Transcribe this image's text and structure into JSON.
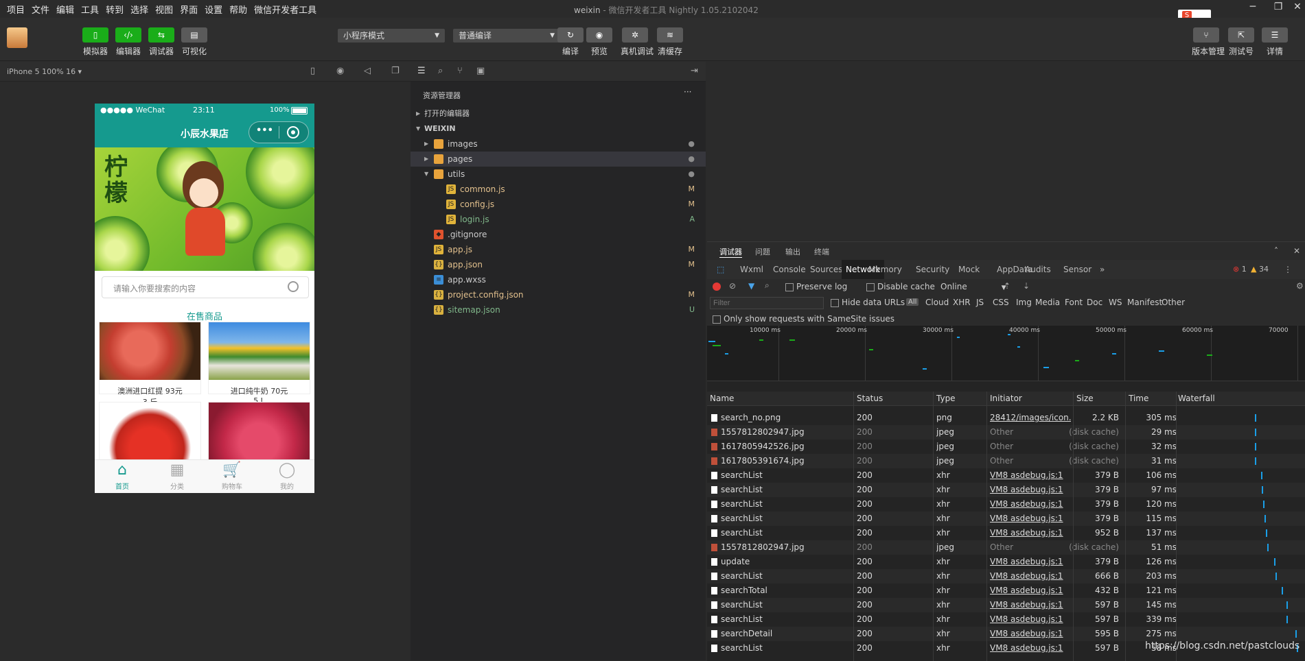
{
  "menu": [
    "项目",
    "文件",
    "编辑",
    "工具",
    "转到",
    "选择",
    "视图",
    "界面",
    "设置",
    "帮助",
    "微信开发者工具"
  ],
  "window": {
    "title": "weixin",
    "subtitle": "- 微信开发者工具 Nightly 1.05.2102042",
    "minimize": "─",
    "maximize": "❐",
    "close": "✕"
  },
  "toolbar": {
    "left_buttons": [
      {
        "label": "模拟器",
        "icon": "phone-icon"
      },
      {
        "label": "编辑器",
        "icon": "code-icon"
      },
      {
        "label": "调试器",
        "icon": "debug-icon"
      },
      {
        "label": "可视化",
        "icon": "layout-icon"
      }
    ],
    "mode_select": "小程序模式",
    "compile_select": "普通编译",
    "mid_buttons": [
      {
        "label": "编译",
        "icon": "refresh-icon"
      },
      {
        "label": "预览",
        "icon": "eye-icon"
      },
      {
        "label": "真机调试",
        "icon": "bug-icon"
      },
      {
        "label": "清缓存",
        "icon": "layers-icon"
      }
    ],
    "right_buttons": [
      {
        "label": "版本管理",
        "icon": "branch-icon"
      },
      {
        "label": "测试号",
        "icon": "share-icon"
      },
      {
        "label": "详情",
        "icon": "menu-icon"
      }
    ]
  },
  "simulator": {
    "device_label": "iPhone 5 100% 16 ▾",
    "status": {
      "carrier": "●●●●● WeChat",
      "time": "23:11",
      "battery": "100%"
    },
    "nav_title": "小辰水果店",
    "banner_text": "柠檬",
    "search_placeholder": "请输入你要搜索的内容",
    "section_title": "在售商品",
    "products": [
      {
        "name": "澳洲进口红提 93元",
        "spec": "3 斤"
      },
      {
        "name": "进口纯牛奶 70元",
        "spec": "5 L"
      },
      {
        "name": "",
        "spec": ""
      },
      {
        "name": "",
        "spec": ""
      }
    ],
    "tabs": [
      {
        "label": "首页",
        "icon": "home-icon",
        "active": true
      },
      {
        "label": "分类",
        "icon": "grid-icon",
        "active": false
      },
      {
        "label": "购物车",
        "icon": "cart-icon",
        "active": false
      },
      {
        "label": "我的",
        "icon": "user-icon",
        "active": false
      }
    ],
    "accent": "#159a8e"
  },
  "explorer": {
    "header": "资源管理器",
    "more": "···",
    "open_editors": "打开的编辑器",
    "root": "WEIXIN",
    "files": [
      {
        "name": "images",
        "type": "folder",
        "status": "●",
        "depth": 1
      },
      {
        "name": "pages",
        "type": "folder",
        "status": "●",
        "depth": 1
      },
      {
        "name": "utils",
        "type": "folder",
        "status": "●",
        "depth": 1
      },
      {
        "name": "common.js",
        "type": "js",
        "status": "M",
        "depth": 2
      },
      {
        "name": "config.js",
        "type": "js",
        "status": "M",
        "depth": 2
      },
      {
        "name": "login.js",
        "type": "js",
        "status": "A",
        "depth": 2
      },
      {
        "name": ".gitignore",
        "type": "git",
        "status": "",
        "depth": 1
      },
      {
        "name": "app.js",
        "type": "js",
        "status": "M",
        "depth": 1
      },
      {
        "name": "app.json",
        "type": "json",
        "status": "M",
        "depth": 1
      },
      {
        "name": "app.wxss",
        "type": "wxss",
        "status": "",
        "depth": 1
      },
      {
        "name": "project.config.json",
        "type": "json",
        "status": "M",
        "depth": 1
      },
      {
        "name": "sitemap.json",
        "type": "json",
        "status": "U",
        "depth": 1
      }
    ]
  },
  "devtools": {
    "top_tabs": [
      "调试器",
      "问题",
      "输出",
      "终端"
    ],
    "panel_tabs": [
      "Wxml",
      "Console",
      "Sources",
      "Network",
      "Memory",
      "Security",
      "Mock",
      "AppData",
      "Audits",
      "Sensor"
    ],
    "active_panel": "Network",
    "error_count": "1",
    "warn_count": "34",
    "preserve_log": "Preserve log",
    "disable_cache": "Disable cache",
    "throttle": "Online",
    "filter_placeholder": "Filter",
    "hide_data_urls": "Hide data URLs",
    "types": [
      "All",
      "Cloud",
      "XHR",
      "JS",
      "CSS",
      "Img",
      "Media",
      "Font",
      "Doc",
      "WS",
      "Manifest",
      "Other"
    ],
    "samesite": "Only show requests with SameSite issues",
    "ticks": [
      "10000 ms",
      "20000 ms",
      "30000 ms",
      "40000 ms",
      "50000 ms",
      "60000 ms",
      "70000"
    ],
    "columns": [
      "Name",
      "Status",
      "Type",
      "Initiator",
      "Size",
      "Time",
      "Waterfall"
    ],
    "requests": [
      {
        "name": "search_no.png",
        "status": "200",
        "type": "png",
        "initiator": "28412/images/icon...",
        "size": "2.2 KB",
        "time": "305 ms",
        "cached": false,
        "wf": 0.62
      },
      {
        "name": "1557812802947.jpg",
        "status": "200",
        "type": "jpeg",
        "initiator": "Other",
        "size": "(disk cache)",
        "time": "29 ms",
        "cached": true,
        "wf": 0.62
      },
      {
        "name": "1617805942526.jpg",
        "status": "200",
        "type": "jpeg",
        "initiator": "Other",
        "size": "(disk cache)",
        "time": "32 ms",
        "cached": true,
        "wf": 0.62
      },
      {
        "name": "1617805391674.jpg",
        "status": "200",
        "type": "jpeg",
        "initiator": "Other",
        "size": "(disk cache)",
        "time": "31 ms",
        "cached": true,
        "wf": 0.62
      },
      {
        "name": "searchList",
        "status": "200",
        "type": "xhr",
        "initiator": "VM8 asdebug.js:1",
        "size": "379 B",
        "time": "106 ms",
        "cached": false,
        "wf": 0.67
      },
      {
        "name": "searchList",
        "status": "200",
        "type": "xhr",
        "initiator": "VM8 asdebug.js:1",
        "size": "379 B",
        "time": "97 ms",
        "cached": false,
        "wf": 0.68
      },
      {
        "name": "searchList",
        "status": "200",
        "type": "xhr",
        "initiator": "VM8 asdebug.js:1",
        "size": "379 B",
        "time": "120 ms",
        "cached": false,
        "wf": 0.69
      },
      {
        "name": "searchList",
        "status": "200",
        "type": "xhr",
        "initiator": "VM8 asdebug.js:1",
        "size": "379 B",
        "time": "115 ms",
        "cached": false,
        "wf": 0.7
      },
      {
        "name": "searchList",
        "status": "200",
        "type": "xhr",
        "initiator": "VM8 asdebug.js:1",
        "size": "952 B",
        "time": "137 ms",
        "cached": false,
        "wf": 0.71
      },
      {
        "name": "1557812802947.jpg",
        "status": "200",
        "type": "jpeg",
        "initiator": "Other",
        "size": "(disk cache)",
        "time": "51 ms",
        "cached": true,
        "wf": 0.72
      },
      {
        "name": "update",
        "status": "200",
        "type": "xhr",
        "initiator": "VM8 asdebug.js:1",
        "size": "379 B",
        "time": "126 ms",
        "cached": false,
        "wf": 0.78
      },
      {
        "name": "searchList",
        "status": "200",
        "type": "xhr",
        "initiator": "VM8 asdebug.js:1",
        "size": "666 B",
        "time": "203 ms",
        "cached": false,
        "wf": 0.79
      },
      {
        "name": "searchTotal",
        "status": "200",
        "type": "xhr",
        "initiator": "VM8 asdebug.js:1",
        "size": "432 B",
        "time": "121 ms",
        "cached": false,
        "wf": 0.84
      },
      {
        "name": "searchList",
        "status": "200",
        "type": "xhr",
        "initiator": "VM8 asdebug.js:1",
        "size": "597 B",
        "time": "145 ms",
        "cached": false,
        "wf": 0.88
      },
      {
        "name": "searchList",
        "status": "200",
        "type": "xhr",
        "initiator": "VM8 asdebug.js:1",
        "size": "597 B",
        "time": "339 ms",
        "cached": false,
        "wf": 0.88
      },
      {
        "name": "searchDetail",
        "status": "200",
        "type": "xhr",
        "initiator": "VM8 asdebug.js:1",
        "size": "595 B",
        "time": "275 ms",
        "cached": false,
        "wf": 0.95
      },
      {
        "name": "searchList",
        "status": "200",
        "type": "xhr",
        "initiator": "VM8 asdebug.js:1",
        "size": "597 B",
        "time": "58 ms",
        "cached": false,
        "wf": 0.96
      }
    ]
  },
  "watermark": "https://blog.csdn.net/pastclouds"
}
